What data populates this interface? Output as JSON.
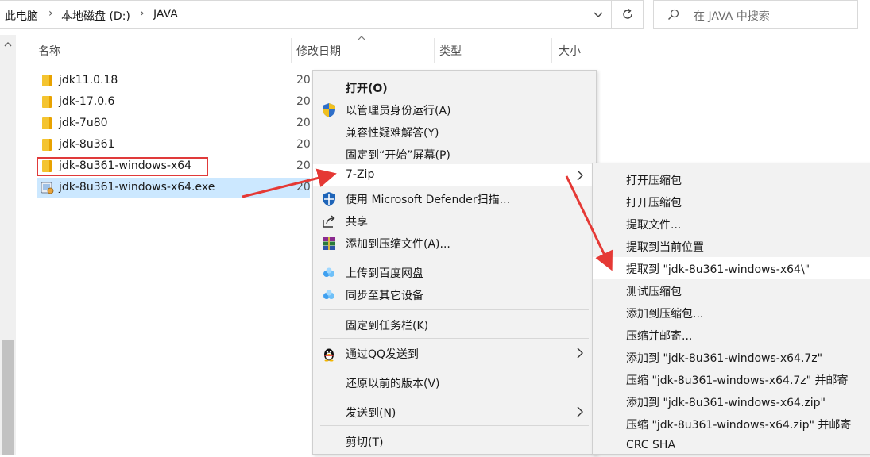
{
  "address": {
    "crumbs": [
      "此电脑",
      "本地磁盘 (D:)",
      "JAVA"
    ]
  },
  "search": {
    "placeholder": "在 JAVA 中搜索"
  },
  "columns": {
    "name": "名称",
    "date": "修改日期",
    "type": "类型",
    "size": "大小"
  },
  "files": [
    {
      "name": "jdk11.0.18",
      "date": "20",
      "kind": "folder"
    },
    {
      "name": "jdk-17.0.6",
      "date": "20",
      "kind": "folder"
    },
    {
      "name": "jdk-7u80",
      "date": "20",
      "kind": "folder"
    },
    {
      "name": "jdk-8u361",
      "date": "20",
      "kind": "folder"
    },
    {
      "name": "jdk-8u361-windows-x64",
      "date": "20",
      "kind": "folder"
    },
    {
      "name": "jdk-8u361-windows-x64.exe",
      "date": "20",
      "kind": "exe"
    }
  ],
  "context_menu": {
    "open": "打开(O)",
    "run_as_admin": "以管理员身份运行(A)",
    "compat": "兼容性疑难解答(Y)",
    "pin_start": "固定到“开始”屏幕(P)",
    "sevenzip": "7-Zip",
    "defender": "使用 Microsoft Defender扫描...",
    "share": "共享",
    "add_archive": "添加到压缩文件(A)...",
    "baidu_upload": "上传到百度网盘",
    "sync_device": "同步至其它设备",
    "pin_taskbar": "固定到任务栏(K)",
    "qq_send": "通过QQ发送到",
    "restore": "还原以前的版本(V)",
    "send_to": "发送到(N)",
    "cut": "剪切(T)"
  },
  "submenu": [
    "打开压缩包",
    "打开压缩包",
    "提取文件...",
    "提取到当前位置",
    "提取到 \"jdk-8u361-windows-x64\\\"",
    "测试压缩包",
    "添加到压缩包...",
    "压缩并邮寄...",
    "添加到 \"jdk-8u361-windows-x64.7z\"",
    "压缩 \"jdk-8u361-windows-x64.7z\" 并邮寄",
    "添加到 \"jdk-8u361-windows-x64.zip\"",
    "压缩 \"jdk-8u361-windows-x64.zip\" 并邮寄",
    "CRC SHA"
  ],
  "colors": {
    "selection": "#cce8ff",
    "annotation_red": "#e03a3a"
  }
}
